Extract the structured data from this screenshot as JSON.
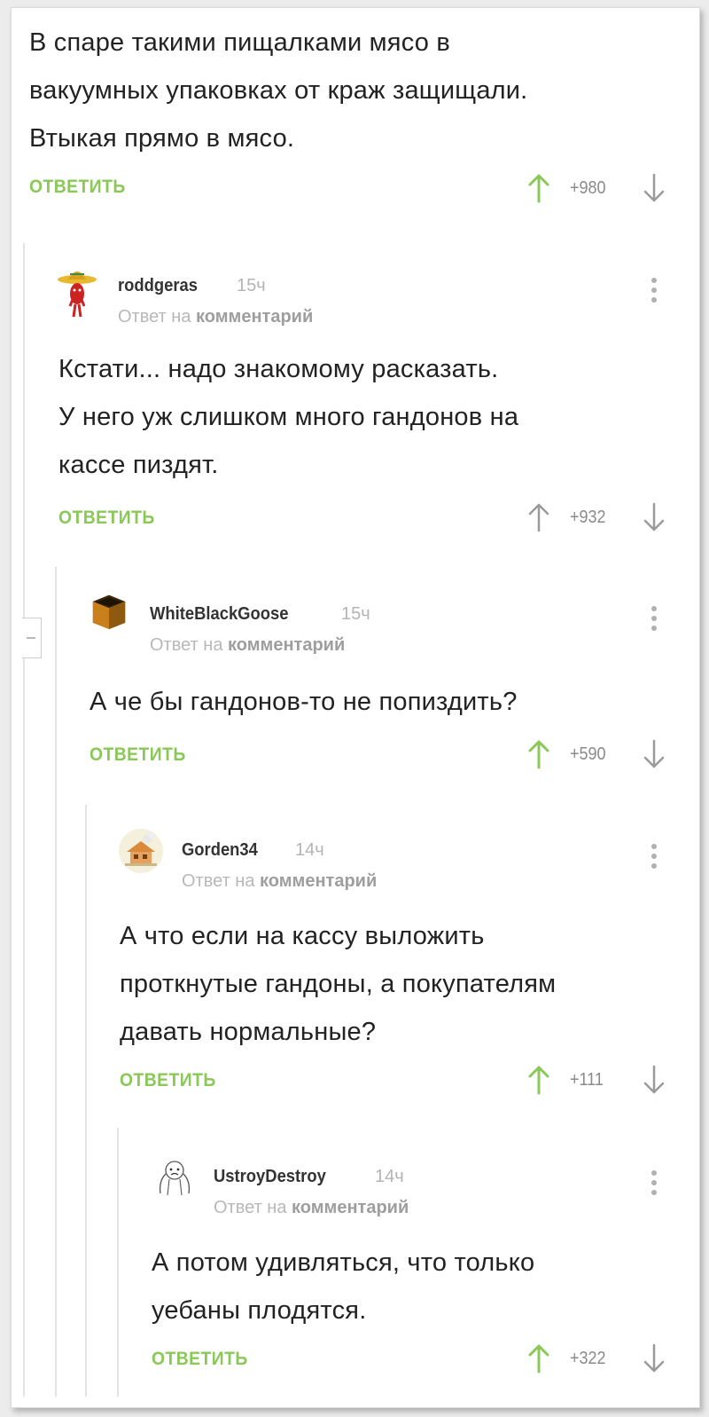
{
  "root": {
    "text": "В спаре такими пищалками мясо в\nвакуумных упаковках от краж защищали.\nВтыкая прямо в мясо.",
    "reply_label": "ОТВЕТИТЬ",
    "rating": "+980",
    "voted": "up"
  },
  "comments": [
    {
      "username": "roddgeras",
      "time": "15ч",
      "reply_to_prefix": "Ответ на",
      "reply_to_link": "комментарий",
      "avatar": "chili-pepper-sombrero-avatar",
      "text": "Кстати... надо знакомому расказать.\nУ него уж слишком много гандонов на\nкассе пиздят.",
      "reply_label": "ОТВЕТИТЬ",
      "rating": "+932",
      "voted": "none"
    },
    {
      "username": "WhiteBlackGoose",
      "time": "15ч",
      "reply_to_prefix": "Ответ на",
      "reply_to_link": "комментарий",
      "avatar": "open-box-avatar",
      "text": "А че бы гандонов-то не попиздить?",
      "reply_label": "ОТВЕТИТЬ",
      "rating": "+590",
      "voted": "up"
    },
    {
      "username": "Gorden34",
      "time": "14ч",
      "reply_to_prefix": "Ответ на",
      "reply_to_link": "комментарий",
      "avatar": "cartoon-house-avatar",
      "text": "А что если на кассу выложить\nпроткнутые гандоны, а покупателям\nдавать нормальные?",
      "reply_label": "ОТВЕТИТЬ",
      "rating": "+111",
      "voted": "up"
    },
    {
      "username": "UstroyDestroy",
      "time": "14ч",
      "reply_to_prefix": "Ответ на",
      "reply_to_link": "комментарий",
      "avatar": "sketch-face-avatar",
      "text": "А потом удивляться, что только\nуебаны плодятся.",
      "reply_label": "ОТВЕТИТЬ",
      "rating": "+322",
      "voted": "up"
    }
  ],
  "colors": {
    "accent_green": "#8ac858",
    "muted_gray": "#8a8a8a",
    "thread_line": "#e3e3e3"
  },
  "icons": {
    "vote_up": "arrow-up-icon",
    "vote_down": "arrow-down-icon",
    "more": "more-vertical-icon",
    "collapse": "collapse-thread-icon"
  }
}
